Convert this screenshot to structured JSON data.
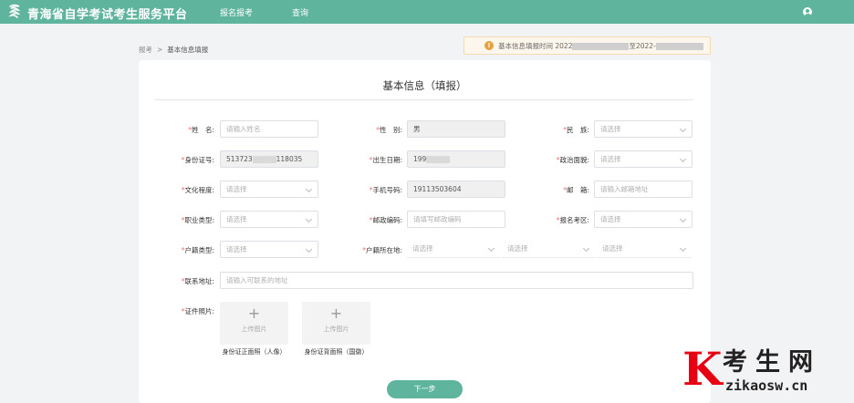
{
  "header": {
    "site_title": "青海省自学考试考生服务平台",
    "nav": [
      "报名报考",
      "查询"
    ]
  },
  "breadcrumb": {
    "root": "报考",
    "sep": ">",
    "current": "基本信息填报"
  },
  "notice": {
    "text_prefix": "基本信息填报时间 2022",
    "text_mid": "至2022-"
  },
  "card": {
    "title": "基本信息（填报）"
  },
  "form": {
    "name": {
      "label": "姓　名:",
      "placeholder": "请输入姓名"
    },
    "gender": {
      "label": "性　别:",
      "value": "男"
    },
    "ethnicity": {
      "label": "民　族:",
      "placeholder": "请选择"
    },
    "id_number": {
      "label": "身份证号:",
      "prefix": "513723",
      "suffix": "118035"
    },
    "birth_date": {
      "label": "出生日期:",
      "prefix": "199"
    },
    "political_status": {
      "label": "政治面貌:",
      "placeholder": "请选择"
    },
    "education": {
      "label": "文化程度:",
      "placeholder": "请选择"
    },
    "phone": {
      "label": "手机号码:",
      "value": "19113503604"
    },
    "email": {
      "label": "邮　箱:",
      "placeholder": "请输入邮箱地址"
    },
    "occupation": {
      "label": "职业类型:",
      "placeholder": "请选择"
    },
    "postal_code": {
      "label": "邮政编码:",
      "placeholder": "请填写邮政编码"
    },
    "exam_area": {
      "label": "报名考区:",
      "placeholder": "请选择"
    },
    "household_type": {
      "label": "户籍类型:",
      "placeholder": "请选择"
    },
    "household_location": {
      "label": "户籍所在地:",
      "placeholders": [
        "请选择",
        "请选择",
        "请选择"
      ]
    },
    "address": {
      "label": "联系地址:",
      "placeholder": "请输入可联系的地址"
    },
    "id_photo": {
      "label": "证件照片:",
      "upload_text": "上传图片",
      "front_caption": "身份证正面照（人像）",
      "back_caption": "身份证背面照（国徽）"
    },
    "required_mark": "*"
  },
  "actions": {
    "next": "下一步"
  },
  "watermark": {
    "k": "K",
    "cn": "考生网",
    "en": "zikaosw.cn"
  },
  "colors": {
    "brand": "#5fb49d",
    "required": "#f56c6c",
    "notice_bg": "#fdf6ec",
    "watermark_red": "#e60012"
  }
}
